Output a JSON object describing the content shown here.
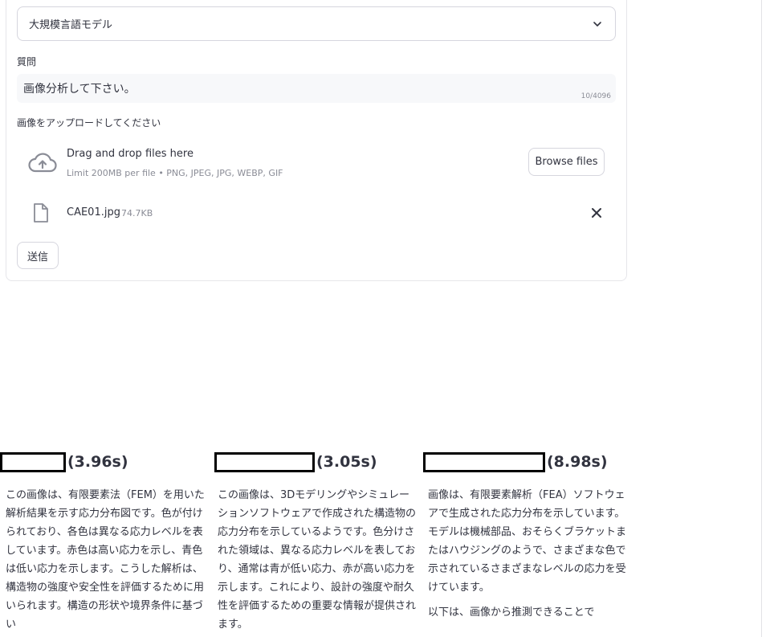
{
  "form": {
    "model_select_value": "大規模言語モデル",
    "question_label": "質問",
    "question_value": "画像分析して下さい。",
    "char_counter": "10/4096",
    "upload_label": "画像をアップロードしてください",
    "dropzone_title": "Drag and drop files here",
    "dropzone_limit": "Limit 200MB per file • PNG, JPEG, JPG, WEBP, GIF",
    "browse_label": "Browse files",
    "file_name": "CAE01.jpg",
    "file_size": "74.7KB",
    "submit_label": "送信"
  },
  "results": [
    {
      "time": "(3.96s)",
      "text": "この画像は、有限要素法（FEM）を用いた解析結果を示す応力分布図です。色が付けられており、各色は異なる応力レベルを表しています。赤色は高い応力を示し、青色は低い応力を示します。こうした解析は、構造物の強度や安全性を評価するために用いられます。構造の形状や境界条件に基づい"
    },
    {
      "time": "(3.05s)",
      "text": "この画像は、3Dモデリングやシミュレーションソフトウェアで作成された構造物の応力分布を示しているようです。色分けされた領域は、異なる応力レベルを表しており、通常は青が低い応力、赤が高い応力を示します。これにより、設計の強度や耐久性を評価するための重要な情報が提供されます。"
    },
    {
      "time": "(8.98s)",
      "text": "画像は、有限要素解析（FEA）ソフトウェアで生成された応力分布を示しています。モデルは機械部品、おそらくブラケットまたはハウジングのようで、さまざまな色で示されているさまざまなレベルの応力を受けています。",
      "text2": "以下は、画像から推測できることで"
    }
  ]
}
